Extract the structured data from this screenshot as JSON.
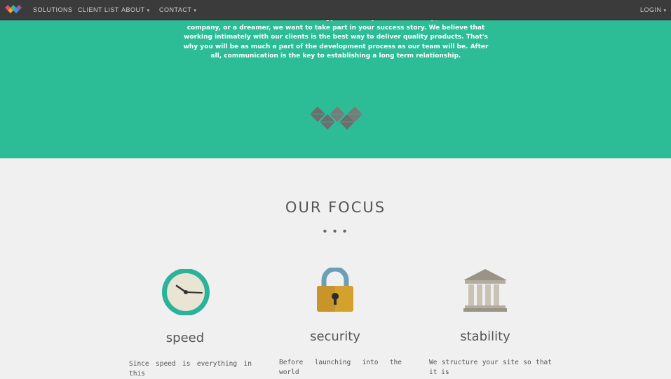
{
  "nav": {
    "items": [
      {
        "label": "SOLUTIONS"
      },
      {
        "label": "CLIENT LIST"
      },
      {
        "label": "ABOUT"
      },
      {
        "label": "CONTACT"
      }
    ],
    "login": "LOGIN",
    "caret": "▾"
  },
  "hero": {
    "paragraph": "them with the best available technology. Whether you are a start-up, established company, or a dreamer, we want to take part in your success story. We believe that working intimately with our clients is the best way to deliver quality products. That's why you will be as much a part of the development process as our team will be. After all, communication is the key to establishing a long term relationship."
  },
  "focus": {
    "title": "OUR FOCUS",
    "dots": "• • •",
    "features": [
      {
        "title": "speed",
        "icon": "clock-icon",
        "text": "Since speed is everything in this"
      },
      {
        "title": "security",
        "icon": "padlock-icon",
        "text": "Before launching into the world"
      },
      {
        "title": "stability",
        "icon": "bank-icon",
        "text": "We structure your site so that it is"
      }
    ]
  },
  "colors": {
    "navbar": "#3b3b3b",
    "hero": "#2dbd96",
    "body": "#f0f0f0"
  }
}
